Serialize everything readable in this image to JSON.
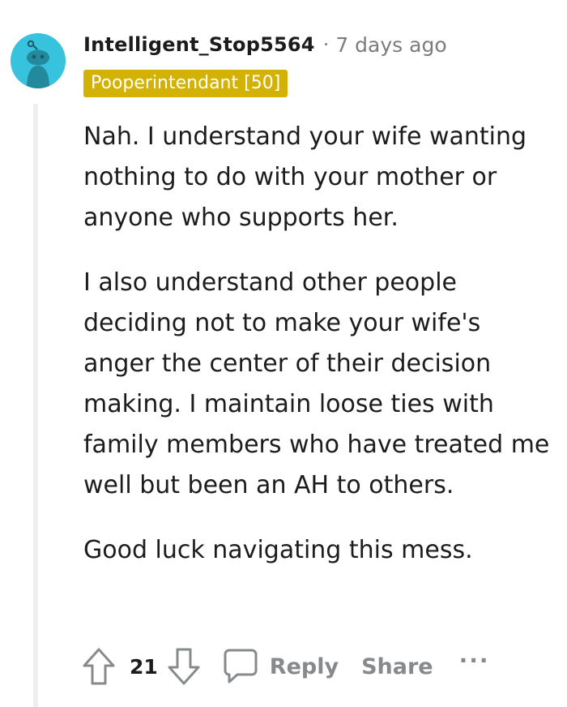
{
  "comment": {
    "username": "Intelligent_Stop5564",
    "separator": "·",
    "timestamp": "7 days ago",
    "flair": "Pooperintendant [50]",
    "paragraphs": [
      "Nah. I understand your wife wanting nothing to do with your mother or anyone who supports her.",
      "I also understand other people deciding not to make your wife's anger the center of their decision making. I maintain loose ties with family members who have treated me well but been an AH to others.",
      "Good luck navigating this mess."
    ],
    "score": "21"
  },
  "actions": {
    "reply_label": "Reply",
    "share_label": "Share",
    "more_label": "···"
  },
  "icons": {
    "avatar": "snoo-avatar-icon",
    "upvote": "upvote-arrow-icon",
    "downvote": "downvote-arrow-icon",
    "reply": "speech-bubble-icon"
  },
  "colors": {
    "flair_bg": "#d3b105",
    "avatar_bg": "#37c2dd",
    "muted_text": "#878a8c",
    "thread_line": "#eeeeee"
  }
}
